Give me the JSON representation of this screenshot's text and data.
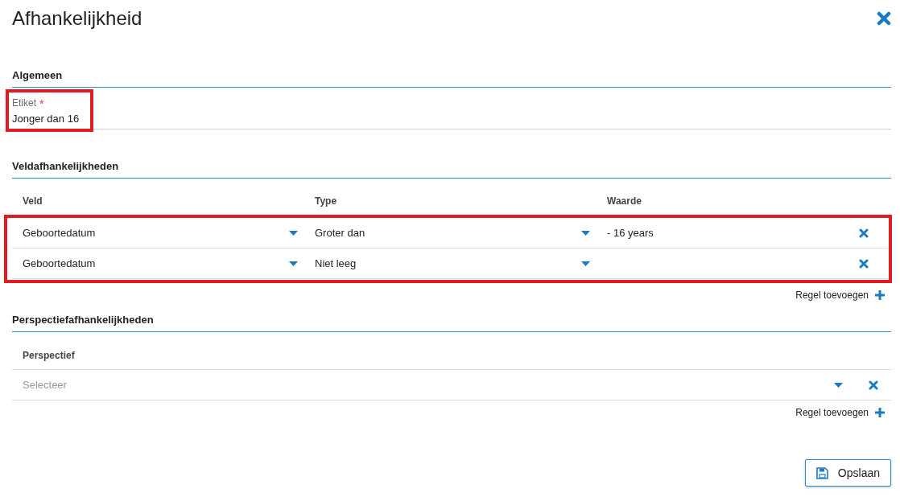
{
  "dialog": {
    "title": "Afhankelijkheid"
  },
  "general": {
    "heading": "Algemeen",
    "field": {
      "label": "Etiket",
      "required_mark": "*",
      "value": "Jonger dan 16",
      "highlighted": true
    }
  },
  "field_dependencies": {
    "heading": "Veldafhankelijkheden",
    "columns": [
      "Veld",
      "Type",
      "Waarde"
    ],
    "highlighted": true,
    "rows": [
      {
        "field": "Geboortedatum",
        "type": "Groter dan",
        "value": "- 16 years"
      },
      {
        "field": "Geboortedatum",
        "type": "Niet leeg",
        "value": ""
      }
    ],
    "add_label": "Regel toevoegen"
  },
  "perspective_dependencies": {
    "heading": "Perspectiefafhankelijkheden",
    "columns": [
      "Perspectief"
    ],
    "rows": [
      {
        "placeholder": "Selecteer"
      }
    ],
    "add_label": "Regel toevoegen"
  },
  "save_button": "Opslaan"
}
